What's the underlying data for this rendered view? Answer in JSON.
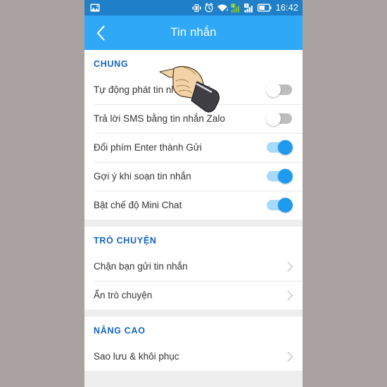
{
  "statusbar": {
    "time": "16:42",
    "icons_left": [
      "photo-icon"
    ],
    "icons_right": [
      "vibrate-icon",
      "alarm-icon",
      "wifi-icon",
      "signal-sim1-icon",
      "signal-sim2-icon",
      "battery-icon"
    ],
    "colors": {
      "background": "#1f7fc9",
      "sim1_signal": "#76c043",
      "foreground": "#ffffff"
    }
  },
  "header": {
    "title": "Tin nhắn",
    "back_icon": "chevron-left-icon",
    "color": "#2fa8f8"
  },
  "sections": [
    {
      "title": "CHUNG",
      "rows": [
        {
          "label": "Tự động phát tin nhắn thoại",
          "control": "toggle",
          "state": "off"
        },
        {
          "label": "Trả lời SMS bằng tin nhắn Zalo",
          "control": "toggle",
          "state": "off"
        },
        {
          "label": "Đổi phím Enter thành Gửi",
          "control": "toggle",
          "state": "on"
        },
        {
          "label": "Gợi ý khi soạn tin nhắn",
          "control": "toggle",
          "state": "on"
        },
        {
          "label": "Bật chế độ Mini Chat",
          "control": "toggle",
          "state": "on"
        }
      ]
    },
    {
      "title": "TRÒ CHUYỆN",
      "rows": [
        {
          "label": "Chặn bạn gửi tin nhắn",
          "control": "chevron"
        },
        {
          "label": "Ẩn trò chuyện",
          "control": "chevron"
        }
      ]
    },
    {
      "title": "NÂNG CAO",
      "rows": [
        {
          "label": "Sao lưu & khôi phục",
          "control": "chevron"
        }
      ]
    }
  ],
  "cursor": {
    "type": "pointing-hand-cursor"
  },
  "theme": {
    "section_title_color": "#1565c0",
    "row_label_color": "#333333",
    "toggle_on_color": "#1e9bf0",
    "toggle_off_color": "#bdbdbd",
    "page_background": "#eeeeee",
    "outer_background": "#aaa2a0"
  }
}
